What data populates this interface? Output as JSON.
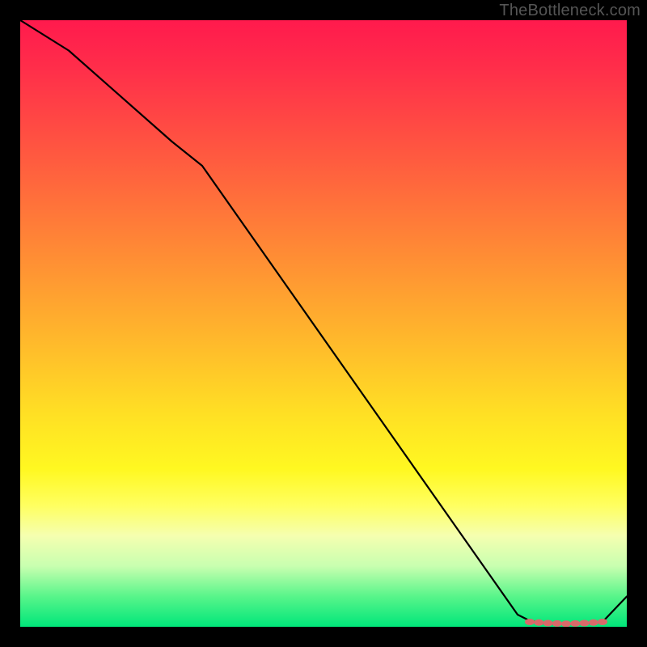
{
  "attribution": "TheBottleneck.com",
  "chart_data": {
    "type": "line",
    "title": "",
    "xlabel": "",
    "ylabel": "",
    "xlim": [
      0,
      100
    ],
    "ylim": [
      0,
      100
    ],
    "series": [
      {
        "name": "curve",
        "x": [
          0,
          8,
          25,
          30,
          82,
          84,
          86,
          88,
          90,
          92,
          94,
          96,
          100
        ],
        "values": [
          100,
          95,
          80,
          76,
          2,
          1,
          0.6,
          0.5,
          0.5,
          0.5,
          0.6,
          0.8,
          5
        ]
      }
    ],
    "markers": {
      "name": "bottom-band",
      "x": [
        84,
        85.5,
        87,
        88.5,
        90,
        91.5,
        93,
        94.5,
        96
      ],
      "values": [
        0.8,
        0.7,
        0.6,
        0.55,
        0.5,
        0.55,
        0.6,
        0.7,
        0.8
      ],
      "color": "#d86a6a"
    },
    "gradient_stops": [
      {
        "pos": 0,
        "color": "#ff1a4d"
      },
      {
        "pos": 22,
        "color": "#ff5840"
      },
      {
        "pos": 52,
        "color": "#ffb62c"
      },
      {
        "pos": 74,
        "color": "#fff821"
      },
      {
        "pos": 90,
        "color": "#c8ffb0"
      },
      {
        "pos": 100,
        "color": "#00e67a"
      }
    ]
  }
}
